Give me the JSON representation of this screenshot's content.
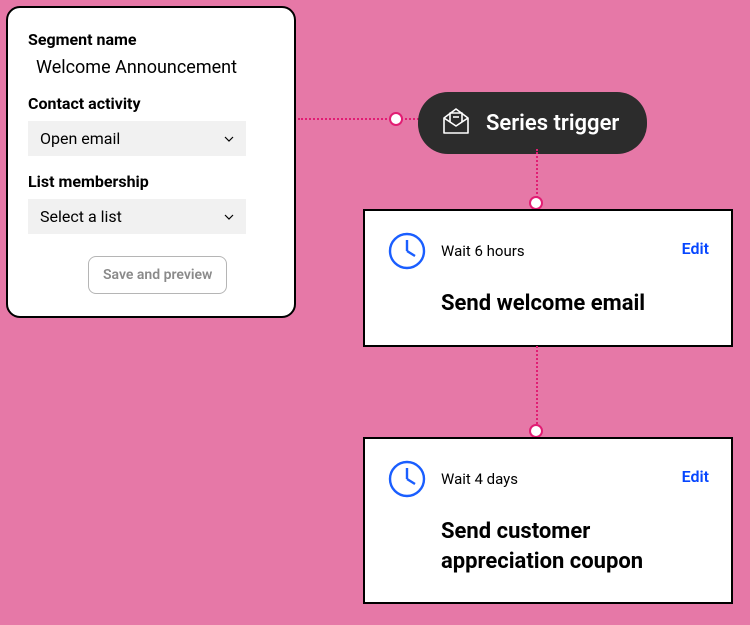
{
  "segment_form": {
    "name_label": "Segment name",
    "name_value": "Welcome  Announcement",
    "activity_label": "Contact activity",
    "activity_value": "Open email",
    "list_label": "List membership",
    "list_value": "Select a list",
    "save_button": "Save and preview"
  },
  "trigger": {
    "label": "Series trigger"
  },
  "steps": [
    {
      "wait": "Wait 6 hours",
      "edit": "Edit",
      "title": "Send welcome email"
    },
    {
      "wait": "Wait 4 days",
      "edit": "Edit",
      "title": "Send customer appreciation coupon"
    }
  ],
  "colors": {
    "bg": "#e678a7",
    "accent": "#e11d73",
    "link": "#0646ff",
    "clock": "#1a5eff"
  }
}
